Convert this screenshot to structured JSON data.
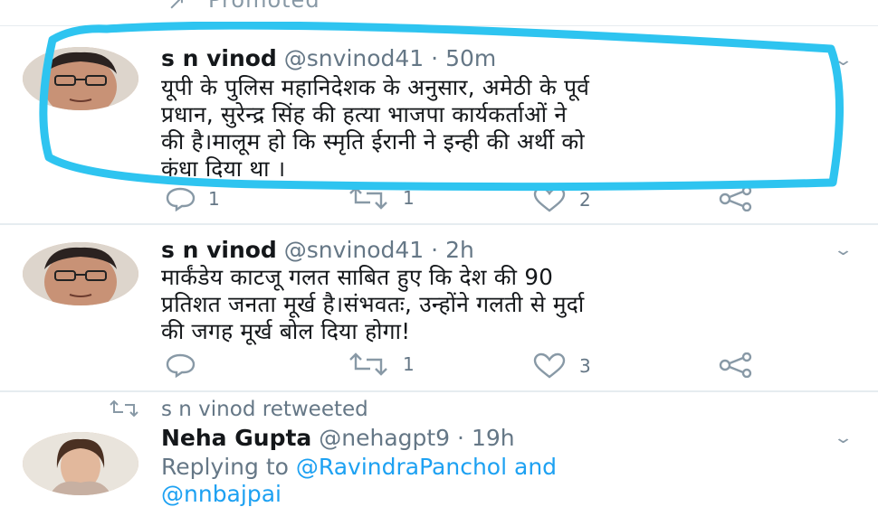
{
  "promoted": {
    "label": "Promoted"
  },
  "tweets": [
    {
      "name": "s n vinod",
      "handle": "@snvinod41",
      "time": "50m",
      "lines": [
        "यूपी के पुलिस महानिदेशक के अनुसार, अमेठी के पूर्व",
        "प्रधान, सुरेन्द्र सिंह की हत्या भाजपा कार्यकर्ताओं ने",
        "की है।मालूम हो कि स्मृति ईरानी ने इन्ही की अर्थी को",
        "कंधा दिया था ।"
      ],
      "replies": "1",
      "retweets": "1",
      "likes": "2"
    },
    {
      "name": "s n vinod",
      "handle": "@snvinod41",
      "time": "2h",
      "lines": [
        "मार्कंडेय काटजू गलत साबित हुए कि देश की 90",
        "प्रतिशत जनता मूर्ख है।संभवतः, उन्होंने गलती से मुर्दा",
        "की जगह मूर्ख बोल दिया होगा!"
      ],
      "replies": "",
      "retweets": "1",
      "likes": "3"
    }
  ],
  "retweet_notice": "s n vinod retweeted",
  "third_tweet": {
    "name": "Neha Gupta",
    "handle": "@nehagpt9",
    "time": "19h",
    "replying_prefix": "Replying to",
    "replying_to": "@RavindraPanchol and",
    "replying_more": "@nnbajpai"
  },
  "colors": {
    "highlight": "#2ec4f0",
    "link": "#1da1f2",
    "meta": "#657786"
  },
  "icons": [
    "reply-icon",
    "retweet-icon",
    "like-icon",
    "share-icon",
    "chevron-down-icon"
  ]
}
